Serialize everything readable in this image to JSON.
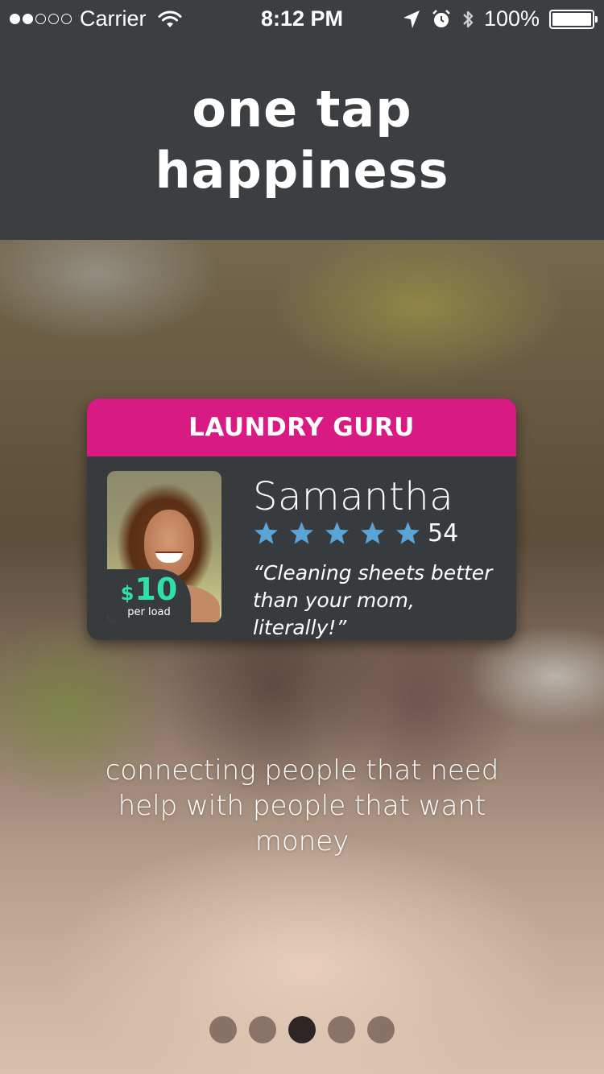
{
  "status_bar": {
    "carrier": "Carrier",
    "time": "8:12 PM",
    "battery": "100%",
    "signal_bars_filled": 2,
    "signal_bars_total": 5
  },
  "header": {
    "title_line1": "one tap",
    "title_line2": "happiness"
  },
  "card": {
    "title": "LAUNDRY GURU",
    "name": "Samantha",
    "rating_stars": 5,
    "rating_count": "54",
    "quote_line1": "“Cleaning sheets better",
    "quote_line2": "than your mom, literally!”",
    "price_symbol": "$",
    "price_value": "10",
    "price_unit": "per load",
    "colors": {
      "header": "#d91a83",
      "price": "#2fe0a8",
      "stars": "#5aa4d6"
    }
  },
  "tagline": "connecting people that need help with people that want money",
  "pager": {
    "total": 5,
    "active_index": 2
  }
}
